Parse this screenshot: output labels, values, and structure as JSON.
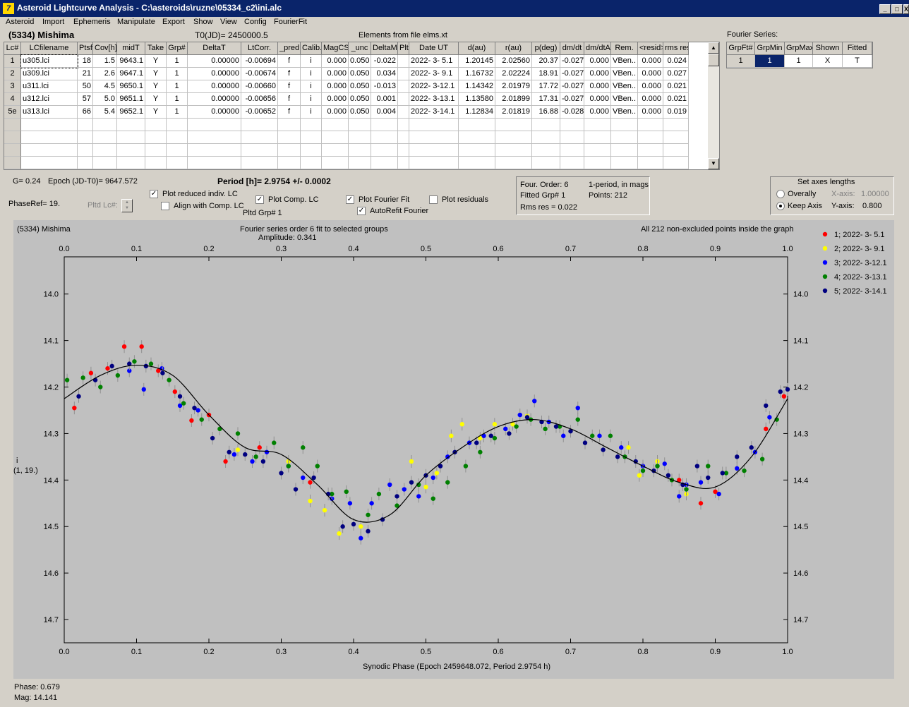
{
  "window": {
    "title": "Asteroid Lightcurve Analysis - C:\\asteroids\\ruzne\\05334_c2\\ini.alc",
    "icon": "app-icon",
    "buttons": [
      "_",
      "□",
      "X"
    ]
  },
  "menu": [
    "Asteroid",
    "Import",
    "Ephemeris",
    "Manipulate",
    "Export",
    "Show",
    "View",
    "Config",
    "FourierFit"
  ],
  "header": {
    "asteroid": "(5334) Mishima",
    "t0": "T0(JD)= 2450000.5",
    "elements": "Elements from file elms.xt"
  },
  "lc_table": {
    "columns": [
      "Lc#",
      "LCfilename",
      "Ptsf",
      "Cov[h]",
      "midT",
      "Take",
      "Grp#",
      "DeltaT",
      "LtCorr.",
      "_pred.",
      "Calib.",
      "MagCS",
      "_unc",
      "DeltaM",
      "Plt",
      "Date UT",
      "d(au)",
      "r(au)",
      "p(deg)",
      "dm/dt",
      "dm/dtA",
      "Rem.",
      "<resid>",
      "rms res"
    ],
    "rows": [
      [
        "1",
        "u305.lci",
        "18",
        "1.5",
        "9643.1",
        "Y",
        "1",
        "0.00000",
        "-0.00694",
        "f",
        "i",
        "0.000",
        "0.050",
        "-0.022",
        "",
        "2022- 3- 5.1",
        "1.20145",
        "2.02560",
        "20.37",
        "-0.027",
        "0.000",
        "VBen..",
        "0.000",
        "0.024"
      ],
      [
        "2",
        "u309.lci",
        "21",
        "2.6",
        "9647.1",
        "Y",
        "1",
        "0.00000",
        "-0.00674",
        "f",
        "i",
        "0.000",
        "0.050",
        "0.034",
        "",
        "2022- 3- 9.1",
        "1.16732",
        "2.02224",
        "18.91",
        "-0.027",
        "0.000",
        "VBen..",
        "0.000",
        "0.027"
      ],
      [
        "3",
        "u311.lci",
        "50",
        "4.5",
        "9650.1",
        "Y",
        "1",
        "0.00000",
        "-0.00660",
        "f",
        "i",
        "0.000",
        "0.050",
        "-0.013",
        "",
        "2022- 3-12.1",
        "1.14342",
        "2.01979",
        "17.72",
        "-0.027",
        "0.000",
        "VBen..",
        "0.000",
        "0.021"
      ],
      [
        "4",
        "u312.lci",
        "57",
        "5.0",
        "9651.1",
        "Y",
        "1",
        "0.00000",
        "-0.00656",
        "f",
        "i",
        "0.000",
        "0.050",
        "0.001",
        "",
        "2022- 3-13.1",
        "1.13580",
        "2.01899",
        "17.31",
        "-0.027",
        "0.000",
        "VBen..",
        "0.000",
        "0.021"
      ],
      [
        "5e",
        "u313.lci",
        "66",
        "5.4",
        "9652.1",
        "Y",
        "1",
        "0.00000",
        "-0.00652",
        "f",
        "i",
        "0.000",
        "0.050",
        "0.004",
        "",
        "2022- 3-14.1",
        "1.12834",
        "2.01819",
        "16.88",
        "-0.028",
        "0.000",
        "VBen..",
        "0.000",
        "0.019"
      ]
    ]
  },
  "fourier_table": {
    "title": "Fourier Series:",
    "columns": [
      "GrpFt#",
      "GrpMin",
      "GrpMax",
      "Shown",
      "Fitted"
    ],
    "row": [
      "1",
      "1",
      "1",
      "X",
      "T"
    ]
  },
  "info": {
    "g": "G= 0.24",
    "epoch": "Epoch (JD-T0)= 9647.572",
    "period": "Period [h]= 2.9754 +/- 0.0002",
    "phaseref": "PhaseRef= 19.",
    "pltd_lc": "Pltd Lc#:",
    "pltd_grp": "Pltd Grp#  1"
  },
  "checks": [
    {
      "label": "Plot reduced indiv. LC",
      "checked": true
    },
    {
      "label": "Align with Comp. LC",
      "checked": false
    },
    {
      "label": "Plot Comp. LC",
      "checked": true
    },
    {
      "label": "Plot Fourier Fit",
      "checked": true
    },
    {
      "label": "Plot residuals",
      "checked": false
    },
    {
      "label": "AutoRefit Fourier",
      "checked": true
    }
  ],
  "fourier_info": {
    "order": "Four. Order:  6",
    "mode": "1-period, in mags",
    "fitted": "Fitted Grp# 1",
    "points": "Points: 212",
    "rms": "Rms res      = 0.022"
  },
  "axes_box": {
    "title": "Set axes lengths",
    "overall": "Overally",
    "keep": "Keep Axis",
    "xaxis": "X-axis:",
    "xval": "1.00000",
    "yaxis": "Y-axis:",
    "yval": "0.800"
  },
  "plot_labels": {
    "left": "(5334) Mishima",
    "center": "Fourier series order 6 fit to selected groups",
    "amp": "Amplitude: 0.341",
    "right": "All 212 non-excluded points inside the graph",
    "ylabel1": "i",
    "ylabel2": "(1, 19.)"
  },
  "status": {
    "phase": "Phase:  0.679",
    "mag": "Mag:    14.141"
  },
  "colors": {
    "titlebar": "#0a246a",
    "plot_bg": "#c0c0c0",
    "g1": "#ff0000",
    "g2": "#ffff00",
    "g3": "#0000ff",
    "g4": "#008000",
    "g5": "#000080"
  },
  "chart_data": {
    "type": "scatter",
    "xlabel": "Synodic Phase (Epoch 2459648.072, Period 2.9754 h)",
    "ylabel": "i",
    "xlim": [
      0,
      1
    ],
    "ylim": [
      14.75,
      13.92
    ],
    "xticks": [
      "0.0",
      "0.1",
      "0.2",
      "0.3",
      "0.4",
      "0.5",
      "0.6",
      "0.7",
      "0.8",
      "0.9",
      "1.0"
    ],
    "yticks": [
      "14.0",
      "14.1",
      "14.2",
      "14.3",
      "14.4",
      "14.5",
      "14.6",
      "14.7"
    ],
    "series": [
      {
        "name": "1; 2022- 3- 5.1",
        "color": "#ff0000",
        "x": [
          0.014,
          0.037,
          0.06,
          0.083,
          0.107,
          0.13,
          0.153,
          0.176,
          0.2,
          0.223,
          0.27,
          0.34,
          0.85,
          0.88,
          0.9,
          0.97,
          0.995
        ],
        "y": [
          14.245,
          14.17,
          14.16,
          14.113,
          14.113,
          14.165,
          14.21,
          14.272,
          14.26,
          14.36,
          14.33,
          14.405,
          14.4,
          14.45,
          14.425,
          14.29,
          14.22
        ]
      },
      {
        "name": "2; 2022- 3- 9.1",
        "color": "#ffff00",
        "x": [
          0.24,
          0.31,
          0.34,
          0.36,
          0.38,
          0.41,
          0.48,
          0.5,
          0.515,
          0.535,
          0.55,
          0.575,
          0.595,
          0.62,
          0.64,
          0.78,
          0.795,
          0.82,
          0.86
        ],
        "y": [
          14.335,
          14.36,
          14.445,
          14.465,
          14.515,
          14.5,
          14.36,
          14.415,
          14.385,
          14.305,
          14.28,
          14.31,
          14.28,
          14.28,
          14.262,
          14.33,
          14.39,
          14.36,
          14.43
        ]
      },
      {
        "name": "3; 2022- 3-12.1",
        "color": "#0000ff",
        "x": [
          0.09,
          0.11,
          0.135,
          0.16,
          0.185,
          0.235,
          0.26,
          0.28,
          0.31,
          0.33,
          0.37,
          0.395,
          0.41,
          0.425,
          0.45,
          0.47,
          0.49,
          0.51,
          0.53,
          0.56,
          0.58,
          0.61,
          0.63,
          0.65,
          0.67,
          0.69,
          0.71,
          0.74,
          0.77,
          0.8,
          0.83,
          0.85,
          0.86,
          0.88,
          0.905,
          0.93,
          0.955,
          0.975
        ],
        "y": [
          14.165,
          14.205,
          14.16,
          14.24,
          14.25,
          14.345,
          14.36,
          14.34,
          14.37,
          14.395,
          14.44,
          14.45,
          14.525,
          14.45,
          14.41,
          14.42,
          14.435,
          14.395,
          14.35,
          14.32,
          14.305,
          14.29,
          14.26,
          14.23,
          14.275,
          14.305,
          14.245,
          14.305,
          14.33,
          14.37,
          14.365,
          14.435,
          14.41,
          14.405,
          14.43,
          14.375,
          14.34,
          14.265
        ]
      },
      {
        "name": "4; 2022- 3-13.1",
        "color": "#008000",
        "x": [
          0.004,
          0.026,
          0.05,
          0.074,
          0.097,
          0.12,
          0.145,
          0.165,
          0.19,
          0.215,
          0.24,
          0.265,
          0.29,
          0.31,
          0.33,
          0.35,
          0.37,
          0.39,
          0.42,
          0.435,
          0.46,
          0.49,
          0.51,
          0.53,
          0.555,
          0.575,
          0.595,
          0.625,
          0.645,
          0.665,
          0.685,
          0.71,
          0.73,
          0.755,
          0.775,
          0.8,
          0.82,
          0.84,
          0.86,
          0.89,
          0.915,
          0.94,
          0.965,
          0.985
        ],
        "y": [
          14.185,
          14.18,
          14.2,
          14.175,
          14.145,
          14.15,
          14.185,
          14.235,
          14.27,
          14.29,
          14.3,
          14.35,
          14.32,
          14.37,
          14.33,
          14.37,
          14.43,
          14.425,
          14.475,
          14.43,
          14.455,
          14.41,
          14.44,
          14.405,
          14.37,
          14.34,
          14.31,
          14.285,
          14.27,
          14.29,
          14.285,
          14.27,
          14.305,
          14.305,
          14.35,
          14.38,
          14.37,
          14.4,
          14.42,
          14.37,
          14.385,
          14.38,
          14.355,
          14.27
        ]
      },
      {
        "name": "5; 2022- 3-14.1",
        "color": "#000080",
        "x": [
          0.02,
          0.043,
          0.066,
          0.09,
          0.113,
          0.136,
          0.16,
          0.18,
          0.205,
          0.228,
          0.25,
          0.275,
          0.3,
          0.32,
          0.345,
          0.365,
          0.385,
          0.4,
          0.42,
          0.44,
          0.46,
          0.48,
          0.5,
          0.52,
          0.54,
          0.57,
          0.59,
          0.615,
          0.64,
          0.66,
          0.68,
          0.7,
          0.72,
          0.745,
          0.765,
          0.79,
          0.815,
          0.835,
          0.855,
          0.875,
          0.89,
          0.91,
          0.93,
          0.95,
          0.97,
          0.99,
          1.0
        ],
        "y": [
          14.22,
          14.185,
          14.155,
          14.15,
          14.155,
          14.17,
          14.22,
          14.245,
          14.31,
          14.34,
          14.345,
          14.36,
          14.385,
          14.42,
          14.395,
          14.43,
          14.5,
          14.495,
          14.51,
          14.485,
          14.435,
          14.405,
          14.39,
          14.37,
          14.34,
          14.32,
          14.305,
          14.3,
          14.265,
          14.275,
          14.285,
          14.295,
          14.32,
          14.335,
          14.35,
          14.36,
          14.38,
          14.39,
          14.41,
          14.37,
          14.395,
          14.385,
          14.35,
          14.33,
          14.24,
          14.21,
          14.205
        ]
      }
    ],
    "fit": {
      "x": [
        0,
        0.05,
        0.1,
        0.15,
        0.2,
        0.25,
        0.3,
        0.35,
        0.4,
        0.45,
        0.5,
        0.55,
        0.6,
        0.65,
        0.7,
        0.75,
        0.8,
        0.85,
        0.9,
        0.95,
        1.0
      ],
      "y": [
        14.225,
        14.175,
        14.153,
        14.175,
        14.26,
        14.33,
        14.345,
        14.41,
        14.485,
        14.475,
        14.39,
        14.33,
        14.285,
        14.27,
        14.29,
        14.33,
        14.37,
        14.405,
        14.415,
        14.35,
        14.225
      ]
    }
  }
}
